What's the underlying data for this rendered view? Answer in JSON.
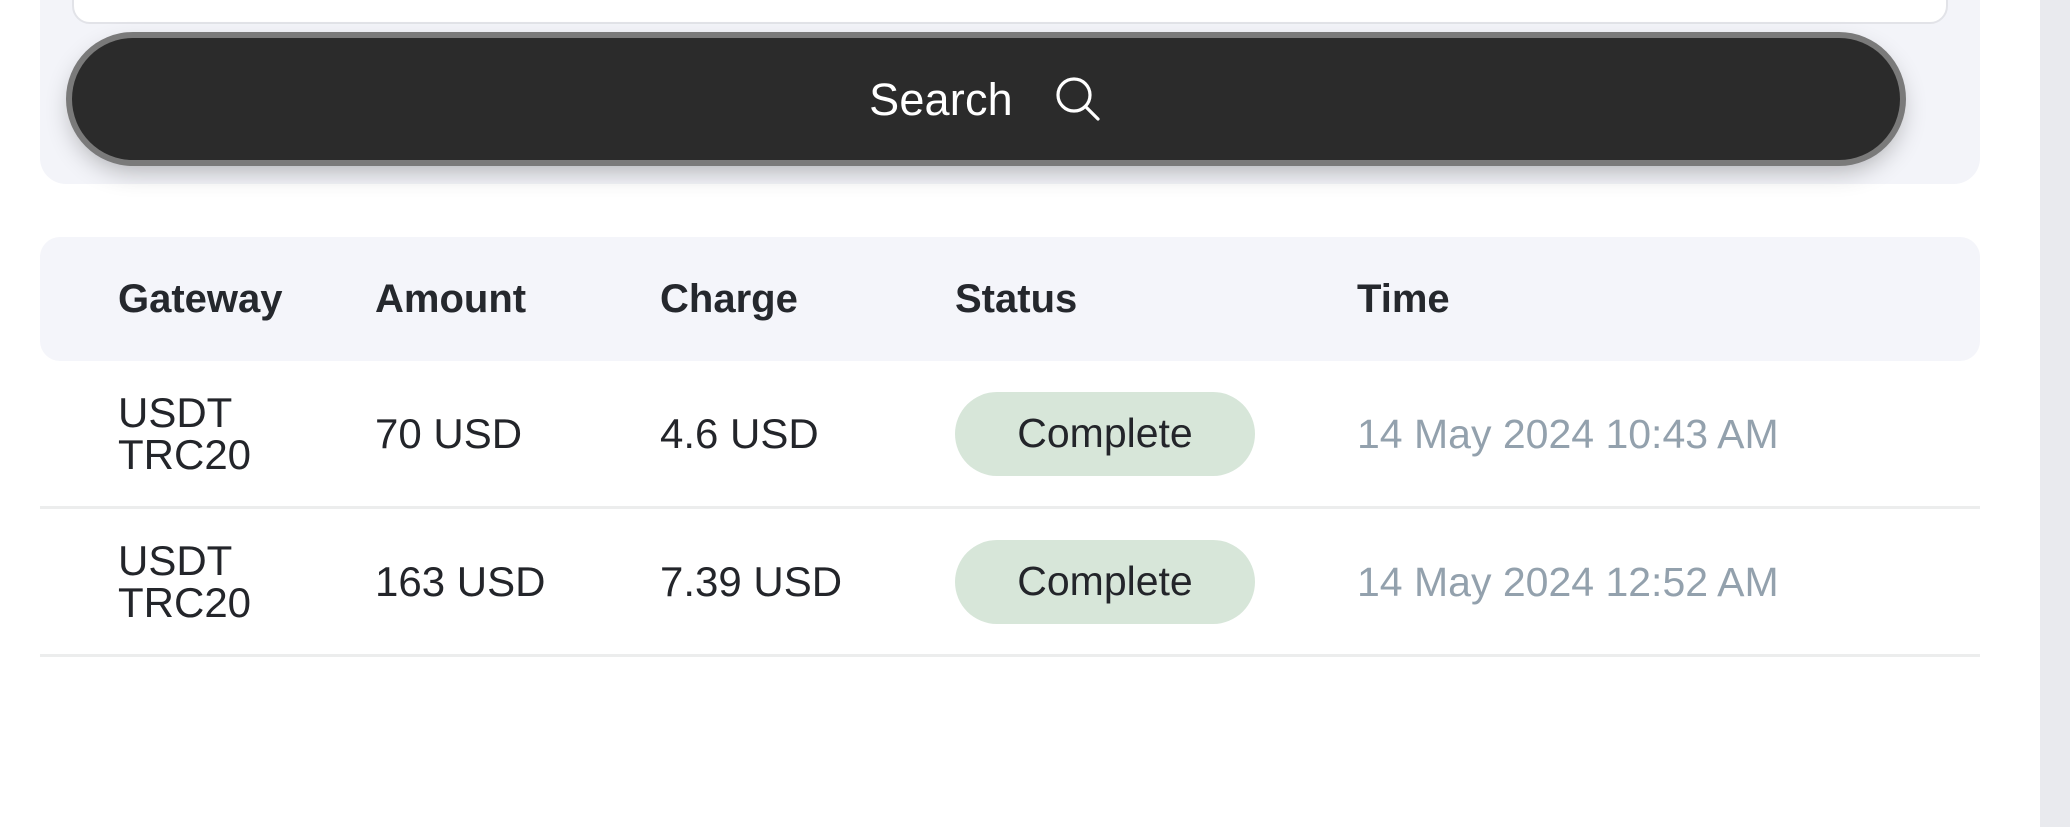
{
  "search": {
    "input_value": "",
    "input_placeholder": "",
    "button_label": "Search",
    "button_icon": "search-icon",
    "button_bg": "#2b2b2b",
    "button_text_color": "#ffffff"
  },
  "table": {
    "header_bg": "#f4f5fa",
    "columns": [
      {
        "key": "gateway",
        "label": "Gateway"
      },
      {
        "key": "amount",
        "label": "Amount"
      },
      {
        "key": "charge",
        "label": "Charge"
      },
      {
        "key": "status",
        "label": "Status"
      },
      {
        "key": "time",
        "label": "Time"
      }
    ],
    "rows": [
      {
        "gateway": "USDT TRC20",
        "amount": "70 USD",
        "charge": "4.6 USD",
        "status": "Complete",
        "status_bg": "#d7e6d9",
        "time": "14 May 2024 10:43 AM"
      },
      {
        "gateway": "USDT TRC20",
        "amount": "163 USD",
        "charge": "7.39 USD",
        "status": "Complete",
        "status_bg": "#d7e6d9",
        "time": "14 May 2024 12:52 AM"
      }
    ]
  },
  "colors": {
    "page_bg": "#ffffff",
    "panel_bg": "#f3f4f9",
    "divider": "#eceded",
    "time_text": "#93a1ad",
    "scrollbar_track": "#e9eaee"
  }
}
